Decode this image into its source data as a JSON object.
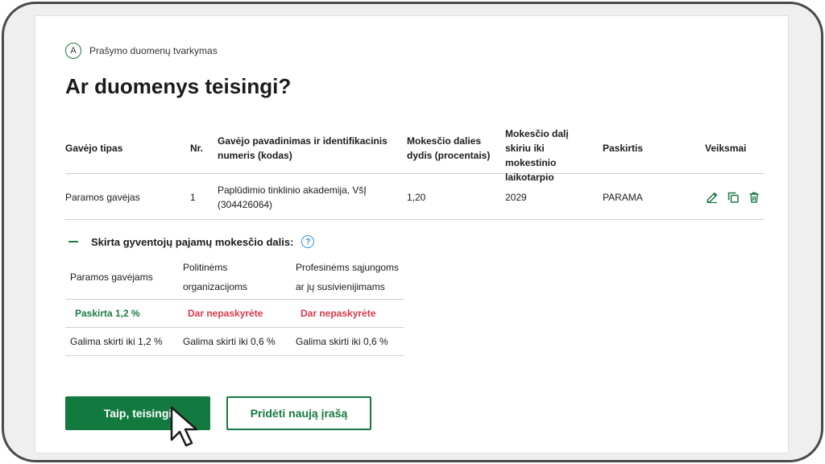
{
  "step": {
    "badge": "A",
    "label": "Prašymo duomenų tvarkymas"
  },
  "page_title": "Ar duomenys teisingi?",
  "table": {
    "headers": {
      "recipient_type": "Gavėjo tipas",
      "nr": "Nr.",
      "name_id": "Gavėjo pavadinimas ir identifikacinis numeris (kodas)",
      "share": "Mokesčio dalies dydis (procentais)",
      "period": "Mokesčio dalį skiriu iki mokestinio laikotarpio",
      "purpose": "Paskirtis",
      "actions": "Veiksmai"
    },
    "rows": [
      {
        "recipient_type": "Paramos gavėjas",
        "nr": "1",
        "name_id": "Paplūdimio tinklinio akademija, VšĮ (304426064)",
        "share": "1,20",
        "period": "2029",
        "purpose": "PARAMA"
      }
    ]
  },
  "icons": {
    "edit": "edit-icon",
    "copy": "copy-icon",
    "delete": "trash-icon",
    "help": "help-icon",
    "collapse": "minus-icon",
    "cursor": "pointer-cursor-icon"
  },
  "section": {
    "title": "Skirta gyventojų pajamų mokesčio dalis:",
    "help_glyph": "?",
    "columns": [
      {
        "header_1": "Paramos gavėjams",
        "header_2": "",
        "status": "Paskirta 1,2 %",
        "limit": "Galima skirti iki 1,2 %"
      },
      {
        "header_1": "Politinėms",
        "header_2": "organizacijoms",
        "status": "Dar nepaskyrėte",
        "limit": "Galima skirti iki 0,6 %"
      },
      {
        "header_1": "Profesinėms sąjungoms",
        "header_2": "ar jų susivienijimams",
        "status": "Dar nepaskyrėte",
        "limit": "Galima skirti iki 0,6 %"
      }
    ]
  },
  "buttons": {
    "confirm": "Taip, teisingi",
    "add_new": "Pridėti naują įrašą"
  },
  "colors": {
    "accent_green": "#137a3f",
    "status_red": "#d63a4b",
    "help_blue": "#2a8fd1"
  }
}
